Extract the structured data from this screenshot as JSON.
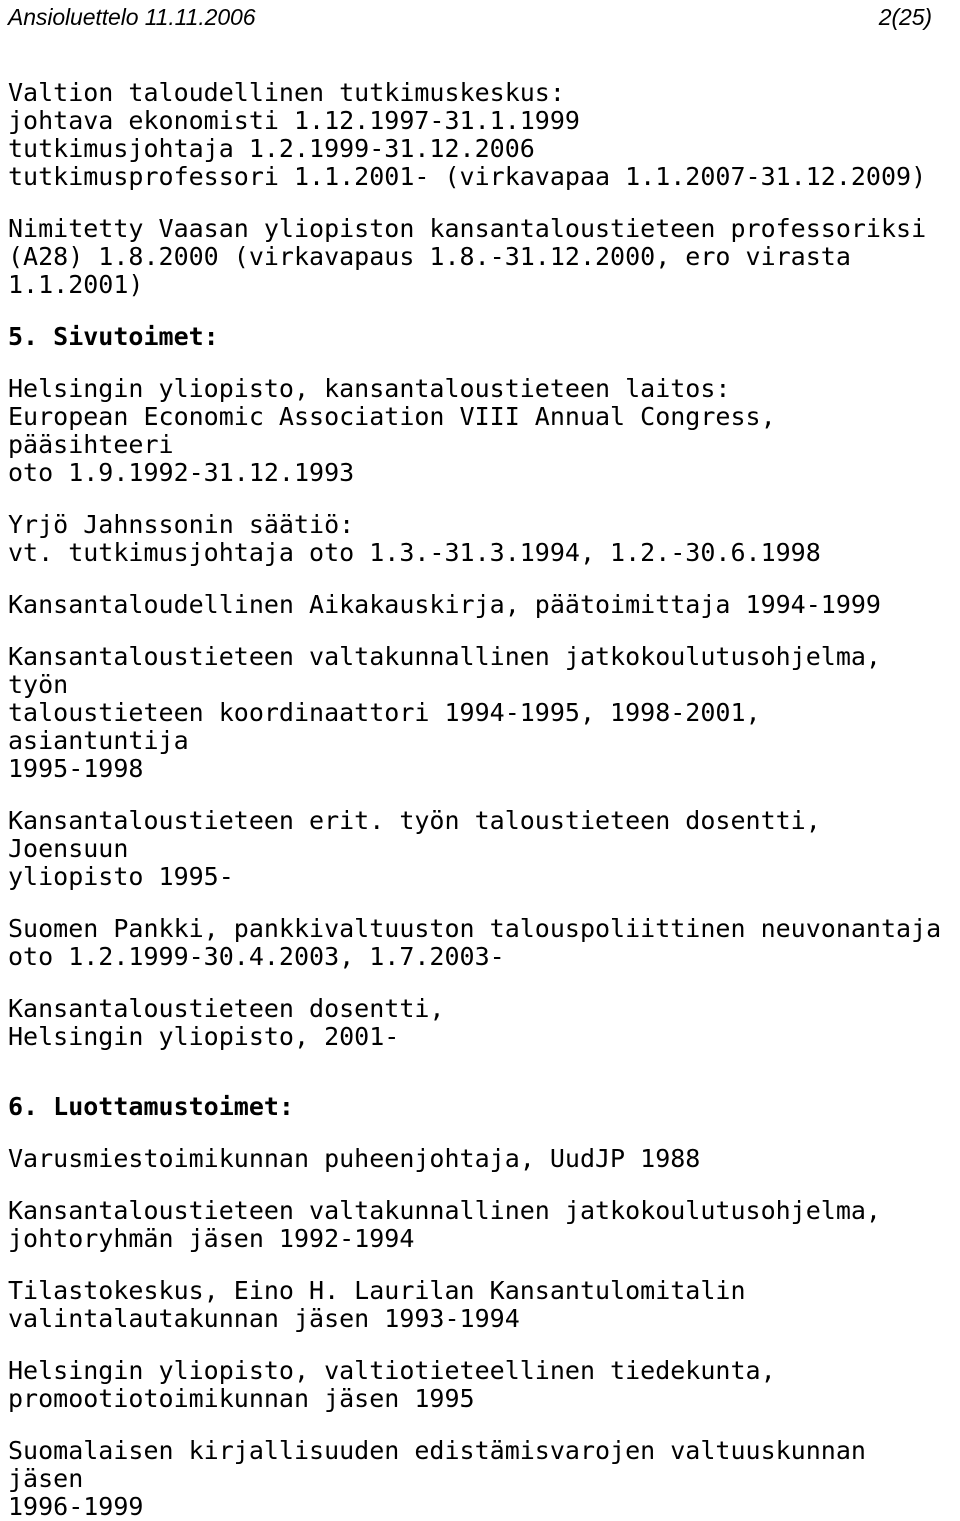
{
  "header": {
    "title": "Ansioluettelo 11.11.2006",
    "page_number": "2(25)"
  },
  "body": {
    "blocks": [
      {
        "id": "vatt-positions",
        "kind": "paragraph",
        "text": "Valtion taloudellinen tutkimuskeskus:\njohtava ekonomisti 1.12.1997-31.1.1999\ntutkimusjohtaja 1.2.1999-31.12.2006\ntutkimusprofessori 1.1.2001- (virkavapaa 1.1.2007-31.12.2009)"
      },
      {
        "id": "vaasa-appointment",
        "kind": "paragraph",
        "text": "Nimitetty Vaasan yliopiston kansantaloustieteen professoriksi\n(A28) 1.8.2000 (virkavapaus 1.8.-31.12.2000, ero virasta\n1.1.2001)"
      },
      {
        "id": "section-5-heading",
        "kind": "heading",
        "text": "5. Sivutoimet:"
      },
      {
        "id": "helsinki-eea",
        "kind": "paragraph",
        "text": "Helsingin yliopisto, kansantaloustieteen laitos:\nEuropean Economic Association VIII Annual Congress, pääsihteeri\noto 1.9.1992-31.12.1993"
      },
      {
        "id": "yrjo-jahnsson",
        "kind": "paragraph",
        "text": "Yrjö Jahnssonin säätiö:\nvt. tutkimusjohtaja oto 1.3.-31.3.1994, 1.2.-30.6.1998"
      },
      {
        "id": "kansantaloudellinen-aikakauskirja",
        "kind": "paragraph",
        "text": "Kansantaloudellinen Aikakauskirja, päätoimittaja 1994-1999"
      },
      {
        "id": "jatkokoulutusohjelma-koordinaattori",
        "kind": "paragraph",
        "text": "Kansantaloustieteen valtakunnallinen jatkokoulutusohjelma, työn\ntaloustieteen koordinaattori 1994-1995, 1998-2001, asiantuntija\n1995-1998"
      },
      {
        "id": "joensuu-dosentti",
        "kind": "paragraph",
        "text": "Kansantaloustieteen erit. työn taloustieteen dosentti, Joensuun\nyliopisto 1995-"
      },
      {
        "id": "suomen-pankki",
        "kind": "paragraph",
        "text": "Suomen Pankki, pankkivaltuuston talouspoliittinen neuvonantaja\noto 1.2.1999-30.4.2003, 1.7.2003-"
      },
      {
        "id": "helsinki-dosentti",
        "kind": "paragraph",
        "text": "Kansantaloustieteen dosentti,\nHelsingin yliopisto, 2001-"
      },
      {
        "id": "section-6-heading",
        "kind": "heading-lg",
        "text": "6. Luottamustoimet:"
      },
      {
        "id": "varusmiestoimikunta",
        "kind": "paragraph",
        "text": "Varusmiestoimikunnan puheenjohtaja, UudJP 1988"
      },
      {
        "id": "jatkokoulutusohjelma-johtoryhma",
        "kind": "paragraph",
        "text": "Kansantaloustieteen valtakunnallinen jatkokoulutusohjelma,\njohtoryhmän jäsen 1992-1994"
      },
      {
        "id": "tilastokeskus",
        "kind": "paragraph",
        "text": "Tilastokeskus, Eino H. Laurilan Kansantulomitalin\nvalintalautakunnan jäsen 1993-1994"
      },
      {
        "id": "promootiotoimikunta",
        "kind": "paragraph",
        "text": "Helsingin yliopisto, valtiotieteellinen tiedekunta,\npromootiotoimikunnan jäsen 1995"
      },
      {
        "id": "kirjallisuuden-edistamisvarat",
        "kind": "paragraph",
        "text": "Suomalaisen kirjallisuuden edistämisvarojen valtuuskunnan jäsen\n1996-1999"
      }
    ]
  }
}
